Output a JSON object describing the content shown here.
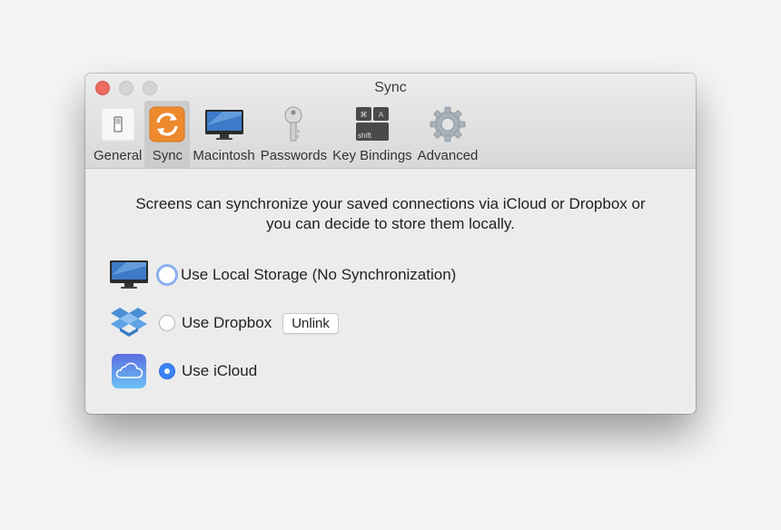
{
  "window": {
    "title": "Sync"
  },
  "toolbar": {
    "tabs": [
      {
        "label": "General",
        "icon": "switch-icon"
      },
      {
        "label": "Sync",
        "icon": "sync-icon",
        "active": true
      },
      {
        "label": "Macintosh",
        "icon": "imac-icon"
      },
      {
        "label": "Passwords",
        "icon": "key-icon"
      },
      {
        "label": "Key Bindings",
        "icon": "keyboard-icon"
      },
      {
        "label": "Advanced",
        "icon": "gear-icon"
      }
    ],
    "keys": {
      "cmd": "⌘",
      "a": "A",
      "shift": "shift"
    }
  },
  "content": {
    "description_line1": "Screens can synchronize your saved connections via iCloud or Dropbox or",
    "description_line2": "you can decide to store them locally.",
    "options": [
      {
        "label": "Use Local Storage (No Synchronization)",
        "selected": false,
        "focused": true
      },
      {
        "label": "Use Dropbox",
        "selected": false,
        "button": "Unlink"
      },
      {
        "label": "Use iCloud",
        "selected": true
      }
    ]
  },
  "colors": {
    "accent": "#3b82f6",
    "sync_orange": "#ee8a2e",
    "close": "#ec6a5e"
  }
}
